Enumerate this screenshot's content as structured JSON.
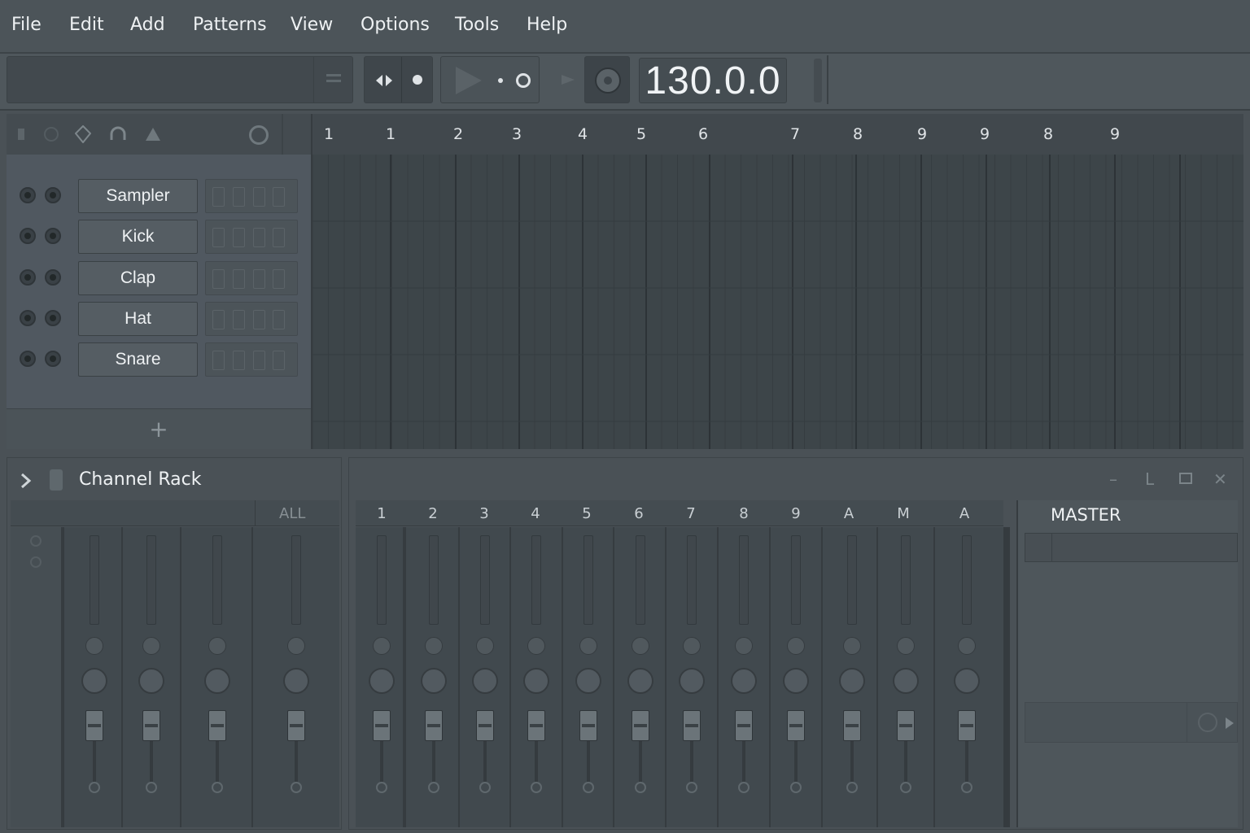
{
  "menu": [
    "File",
    "Edit",
    "Add",
    "Patterns",
    "View",
    "Options",
    "Tools",
    "Help"
  ],
  "toolbar": {
    "tempo": "130.0.0"
  },
  "playlist": {
    "ruler": [
      "1",
      "1",
      "2",
      "3",
      "4",
      "5",
      "6",
      "7",
      "8",
      "9",
      "9",
      "8",
      "9"
    ]
  },
  "channels": [
    "Sampler",
    "Kick",
    "Clap",
    "Hat",
    "Snare"
  ],
  "channel_add": "+",
  "channel_rack": {
    "title": "Channel Rack",
    "all_label": "ALL"
  },
  "mixer": {
    "tracks": [
      "1",
      "2",
      "3",
      "4",
      "5",
      "6",
      "7",
      "8",
      "9",
      "A",
      "M",
      "A"
    ],
    "master_label": "MASTER"
  },
  "window_controls": {
    "minimize": "–",
    "restore": "L",
    "close": "✕"
  }
}
